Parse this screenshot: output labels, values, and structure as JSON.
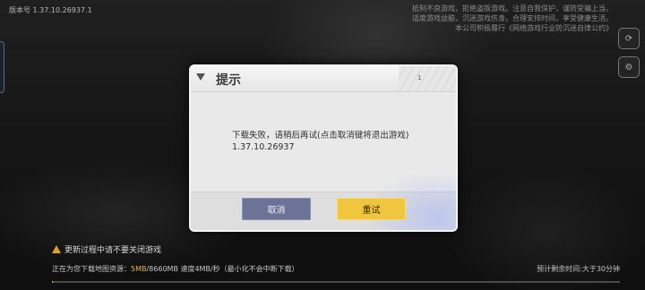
{
  "version_label": "版本号 1.37.10.26937.1",
  "health_notice": [
    "抵制不良游戏，拒绝盗版游戏。注意自我保护，谨防受骗上当。",
    "适度游戏益脑，沉迷游戏伤身。合理安排时间，享受健康生活。",
    "本公司积极履行《网络游戏行业防沉迷自律公约》"
  ],
  "side_buttons": [
    "⟳",
    "⚙"
  ],
  "dialog": {
    "title": "提示",
    "page_indicator": "1",
    "message_line1": "下载失败，请稍后再试(点击取消键将退出游戏)",
    "message_line2": "1.37.10.26937",
    "cancel_label": "取消",
    "retry_label": "重试"
  },
  "footer": {
    "warning": "更新过程中请不要关闭游戏",
    "download_prefix": "正在为您下载地图资源：",
    "download_size": "5MB",
    "download_total": "/8660MB 速度4MB/秒（最小化不会中断下载）",
    "remaining_time": "预计剩余时间:大于30分钟",
    "progress": 0.001
  },
  "colors": {
    "retry": "#f1c63f",
    "cancel": "#6b7396",
    "accent": "#e3b649"
  }
}
